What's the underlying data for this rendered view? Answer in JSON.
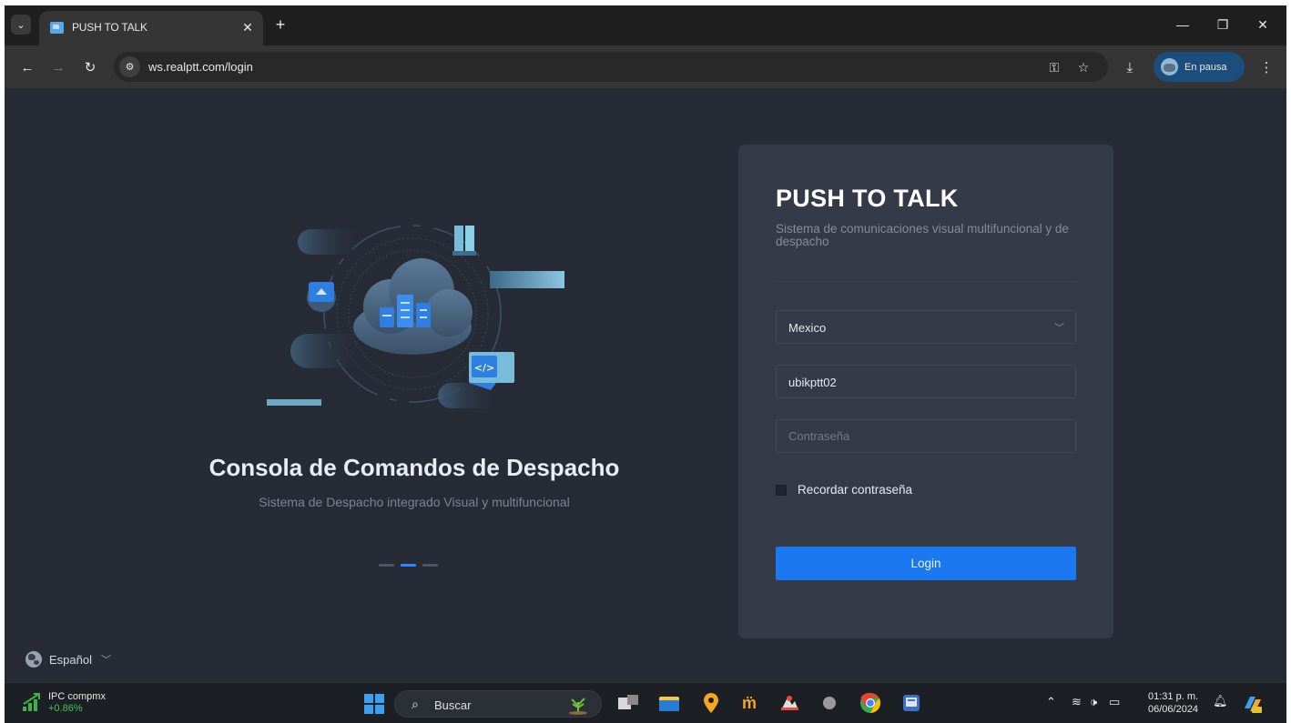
{
  "browser": {
    "tab_title": "PUSH TO TALK",
    "url": "ws.realptt.com/login",
    "profile_label": "En pausa"
  },
  "hero": {
    "title": "Consola de Comandos de Despacho",
    "subtitle": "Sistema de Despacho integrado Visual y multifuncional",
    "carousel_dots": 3,
    "active_dot": 2
  },
  "language": {
    "label": "Español"
  },
  "login": {
    "title": "PUSH TO TALK",
    "subtitle": "Sistema de comunicaciones visual multifuncional y de despacho",
    "region_value": "Mexico",
    "username_value": "ubikptt02",
    "password_placeholder": "Contraseña",
    "remember_label": "Recordar contraseña",
    "remember_checked": false,
    "login_button": "Login"
  },
  "taskbar": {
    "stock_name": "IPC compmx",
    "stock_change": "+0.86%",
    "search_label": "Buscar",
    "time": "01:31 p. m.",
    "date": "06/06/2024"
  },
  "colors": {
    "page_bg": "#262b36",
    "card_bg": "#343a48",
    "accent": "#1a78f0",
    "stock_up": "#42c45a"
  }
}
